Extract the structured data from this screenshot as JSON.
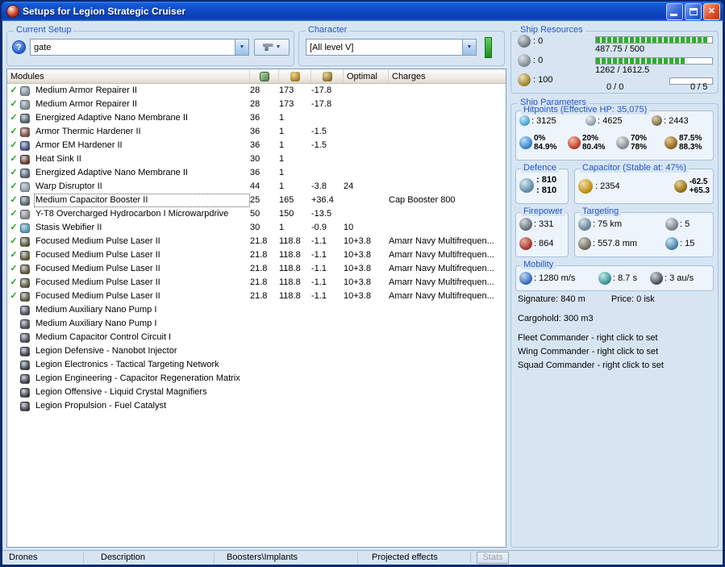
{
  "window": {
    "title": "Setups for Legion Strategic Cruiser"
  },
  "glyphs": {
    "close": "✕",
    "dropdown": "▼",
    "check": "✓",
    "help": "?"
  },
  "colors": {
    "group_label": "#2456c4",
    "check_green": "#1fa51f",
    "bar_green": "#2fae2f",
    "skill_indicator": "#33b133",
    "titlebar_blue": "#0d47c0"
  },
  "current_setup": {
    "label": "Current Setup",
    "value": "gate"
  },
  "character": {
    "label": "Character",
    "value": "[All level V]"
  },
  "ship_resources": {
    "label": "Ship Resources",
    "turrets": ": 0",
    "launchers": ": 0",
    "calibration": ": 100",
    "cpu_text": "487.75 / 500",
    "cpu_pct": 97.5,
    "powergrid_text": "1262 / 1612.5",
    "powergrid_pct": 78,
    "drone_text": "0 / 0",
    "rig_text": "0 / 5",
    "rig_pct": 0
  },
  "modules_table": {
    "title": "Modules",
    "optimal_header": "Optimal",
    "charges_header": "Charges",
    "rows": [
      {
        "f": true,
        "n": "Medium Armor Repairer II",
        "cpu": "28",
        "pg": "173",
        "cap": "-17.8",
        "opt": "",
        "chg": "",
        "sel": false,
        "ic": "#7d8c9a"
      },
      {
        "f": true,
        "n": "Medium Armor Repairer II",
        "cpu": "28",
        "pg": "173",
        "cap": "-17.8",
        "opt": "",
        "chg": "",
        "sel": false,
        "ic": "#7d8c9a"
      },
      {
        "f": true,
        "n": "Energized Adaptive Nano Membrane II",
        "cpu": "36",
        "pg": "1",
        "cap": "",
        "opt": "",
        "chg": "",
        "sel": false,
        "ic": "#4f5f6e"
      },
      {
        "f": true,
        "n": "Armor Thermic Hardener II",
        "cpu": "36",
        "pg": "1",
        "cap": "-1.5",
        "opt": "",
        "chg": "",
        "sel": false,
        "ic": "#8a4838"
      },
      {
        "f": true,
        "n": "Armor EM Hardener II",
        "cpu": "36",
        "pg": "1",
        "cap": "-1.5",
        "opt": "",
        "chg": "",
        "sel": false,
        "ic": "#3a4a8a"
      },
      {
        "f": true,
        "n": "Heat Sink II",
        "cpu": "30",
        "pg": "1",
        "cap": "",
        "opt": "",
        "chg": "",
        "sel": false,
        "ic": "#6a3426"
      },
      {
        "f": true,
        "n": "Energized Adaptive Nano Membrane II",
        "cpu": "36",
        "pg": "1",
        "cap": "",
        "opt": "",
        "chg": "",
        "sel": false,
        "ic": "#4f5f6e"
      },
      {
        "f": true,
        "n": "Warp Disruptor II",
        "cpu": "44",
        "pg": "1",
        "cap": "-3.8",
        "opt": "24",
        "chg": "",
        "sel": false,
        "ic": "#8c9aa8"
      },
      {
        "f": true,
        "n": "Medium Capacitor Booster II",
        "cpu": "25",
        "pg": "165",
        "cap": "+36.4",
        "opt": "",
        "chg": "Cap Booster 800",
        "sel": true,
        "ic": "#56616c"
      },
      {
        "f": true,
        "n": "Y-T8 Overcharged Hydrocarbon I Microwarpdrive",
        "cpu": "50",
        "pg": "150",
        "cap": "-13.5",
        "opt": "",
        "chg": "",
        "sel": false,
        "ic": "#86878a"
      },
      {
        "f": true,
        "n": "Stasis Webifier II",
        "cpu": "30",
        "pg": "1",
        "cap": "-0.9",
        "opt": "10",
        "chg": "",
        "sel": false,
        "ic": "#4a9ab8"
      },
      {
        "f": true,
        "n": "Focused Medium Pulse Laser II",
        "cpu": "21.8",
        "pg": "118.8",
        "cap": "-1.1",
        "opt": "10+3.8",
        "chg": "Amarr Navy Multifrequen...",
        "sel": false,
        "ic": "#5f5430"
      },
      {
        "f": true,
        "n": "Focused Medium Pulse Laser II",
        "cpu": "21.8",
        "pg": "118.8",
        "cap": "-1.1",
        "opt": "10+3.8",
        "chg": "Amarr Navy Multifrequen...",
        "sel": false,
        "ic": "#5f5430"
      },
      {
        "f": true,
        "n": "Focused Medium Pulse Laser II",
        "cpu": "21.8",
        "pg": "118.8",
        "cap": "-1.1",
        "opt": "10+3.8",
        "chg": "Amarr Navy Multifrequen...",
        "sel": false,
        "ic": "#5f5430"
      },
      {
        "f": true,
        "n": "Focused Medium Pulse Laser II",
        "cpu": "21.8",
        "pg": "118.8",
        "cap": "-1.1",
        "opt": "10+3.8",
        "chg": "Amarr Navy Multifrequen...",
        "sel": false,
        "ic": "#5f5430"
      },
      {
        "f": true,
        "n": "Focused Medium Pulse Laser II",
        "cpu": "21.8",
        "pg": "118.8",
        "cap": "-1.1",
        "opt": "10+3.8",
        "chg": "Amarr Navy Multifrequen...",
        "sel": false,
        "ic": "#5f5430"
      },
      {
        "f": false,
        "n": "Medium Auxiliary Nano Pump I",
        "cpu": "",
        "pg": "",
        "cap": "",
        "opt": "",
        "chg": "",
        "sel": false,
        "ic": "#4a4a52"
      },
      {
        "f": false,
        "n": "Medium Auxiliary Nano Pump I",
        "cpu": "",
        "pg": "",
        "cap": "",
        "opt": "",
        "chg": "",
        "sel": false,
        "ic": "#4a4a52"
      },
      {
        "f": false,
        "n": "Medium Capacitor Control Circuit I",
        "cpu": "",
        "pg": "",
        "cap": "",
        "opt": "",
        "chg": "",
        "sel": false,
        "ic": "#4a4a52"
      },
      {
        "f": false,
        "n": "Legion Defensive - Nanobot Injector",
        "cpu": "",
        "pg": "",
        "cap": "",
        "opt": "",
        "chg": "",
        "sel": false,
        "ic": "#3c3c44"
      },
      {
        "f": false,
        "n": "Legion Electronics - Tactical Targeting Network",
        "cpu": "",
        "pg": "",
        "cap": "",
        "opt": "",
        "chg": "",
        "sel": false,
        "ic": "#3c3c44"
      },
      {
        "f": false,
        "n": "Legion Engineering - Capacitor Regeneration Matrix",
        "cpu": "",
        "pg": "",
        "cap": "",
        "opt": "",
        "chg": "",
        "sel": false,
        "ic": "#3c3c44"
      },
      {
        "f": false,
        "n": "Legion Offensive - Liquid Crystal Magnifiers",
        "cpu": "",
        "pg": "",
        "cap": "",
        "opt": "",
        "chg": "",
        "sel": false,
        "ic": "#3c3c44"
      },
      {
        "f": false,
        "n": "Legion Propulsion - Fuel Catalyst",
        "cpu": "",
        "pg": "",
        "cap": "",
        "opt": "",
        "chg": "",
        "sel": false,
        "ic": "#3c3c44"
      }
    ]
  },
  "ship_parameters": {
    "label": "Ship Parameters",
    "hitpoints": {
      "label": "Hitpoints (Effective HP: 35,075)",
      "shield": ": 3125",
      "armor": ": 4625",
      "structure": ": 2443",
      "resists": [
        {
          "top": "0%",
          "bottom": "84.9%"
        },
        {
          "top": "20%",
          "bottom": "80.4%"
        },
        {
          "top": "70%",
          "bottom": "78%"
        },
        {
          "top": "87.5%",
          "bottom": "88.3%"
        }
      ]
    },
    "defence": {
      "label": "Defence",
      "line1": ": 810",
      "line2": ": 810"
    },
    "capacitor": {
      "label": "Capacitor (Stable at: 47%)",
      "amount": ": 2354",
      "drain": "-62.5",
      "recharge": "+65.3"
    },
    "firepower": {
      "label": "Firepower",
      "volley": ": 331",
      "dps": ": 864"
    },
    "targeting": {
      "label": "Targeting",
      "range": ": 75 km",
      "max_targets": ": 5",
      "scan_resolution": ": 557.8 mm",
      "sensor_strength": ": 15"
    },
    "mobility": {
      "label": "Mobility",
      "speed": ": 1280 m/s",
      "agility": ": 8.7 s",
      "warp_speed": ": 3 au/s"
    }
  },
  "info": {
    "signature": "Signature: 840 m",
    "price": "Price: 0 isk",
    "cargohold": "Cargohold: 300 m3",
    "fleet": "Fleet Commander - right click to set",
    "wing": "Wing Commander - right click to set",
    "squad": "Squad Commander - right click to set"
  },
  "bottom_tabs": {
    "drones": "Drones",
    "description": "Description",
    "boosters": "Boosters\\Implants",
    "projected": "Projected effects",
    "stats": "Stats"
  }
}
